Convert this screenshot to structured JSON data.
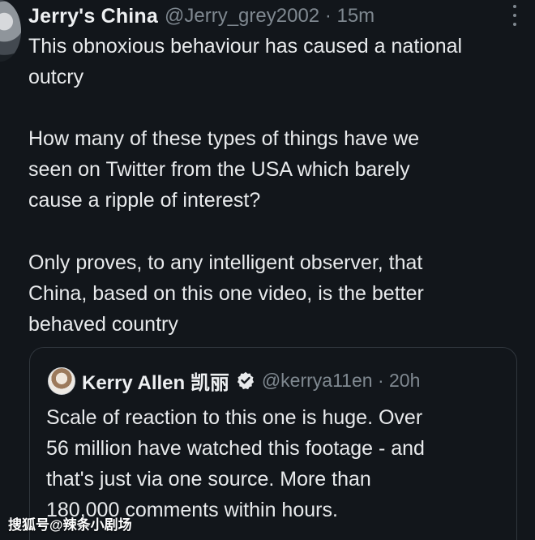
{
  "tweet": {
    "author_name": "Jerry's China",
    "handle": "@Jerry_grey2002",
    "separator": "·",
    "time": "15m",
    "body_lines": [
      "This obnoxious behaviour has caused a national",
      "outcry",
      "",
      "How many of these types of things have we",
      "seen on Twitter from the USA which barely",
      "cause a ripple of interest?",
      "",
      "Only proves, to any intelligent observer, that",
      "China, based on this one video, is the better",
      "behaved country"
    ],
    "menu_icon": "more-vertical-icon"
  },
  "quote": {
    "author_name": "Kerry Allen 凯丽",
    "handle": "@kerrya11en",
    "separator": "·",
    "time": "20h",
    "verified_icon": "verified-badge-icon",
    "body_lines": [
      "Scale of reaction to this one is huge. Over",
      "56 million have watched this footage - and",
      "that's just via one source. More than",
      "180,000 comments within hours."
    ]
  },
  "watermark": {
    "text": "搜狐号@辣条小剧场"
  },
  "colors": {
    "background": "#12161b",
    "primary_text": "#e8eaec",
    "secondary_text": "#7f8890",
    "border": "#30363d"
  }
}
